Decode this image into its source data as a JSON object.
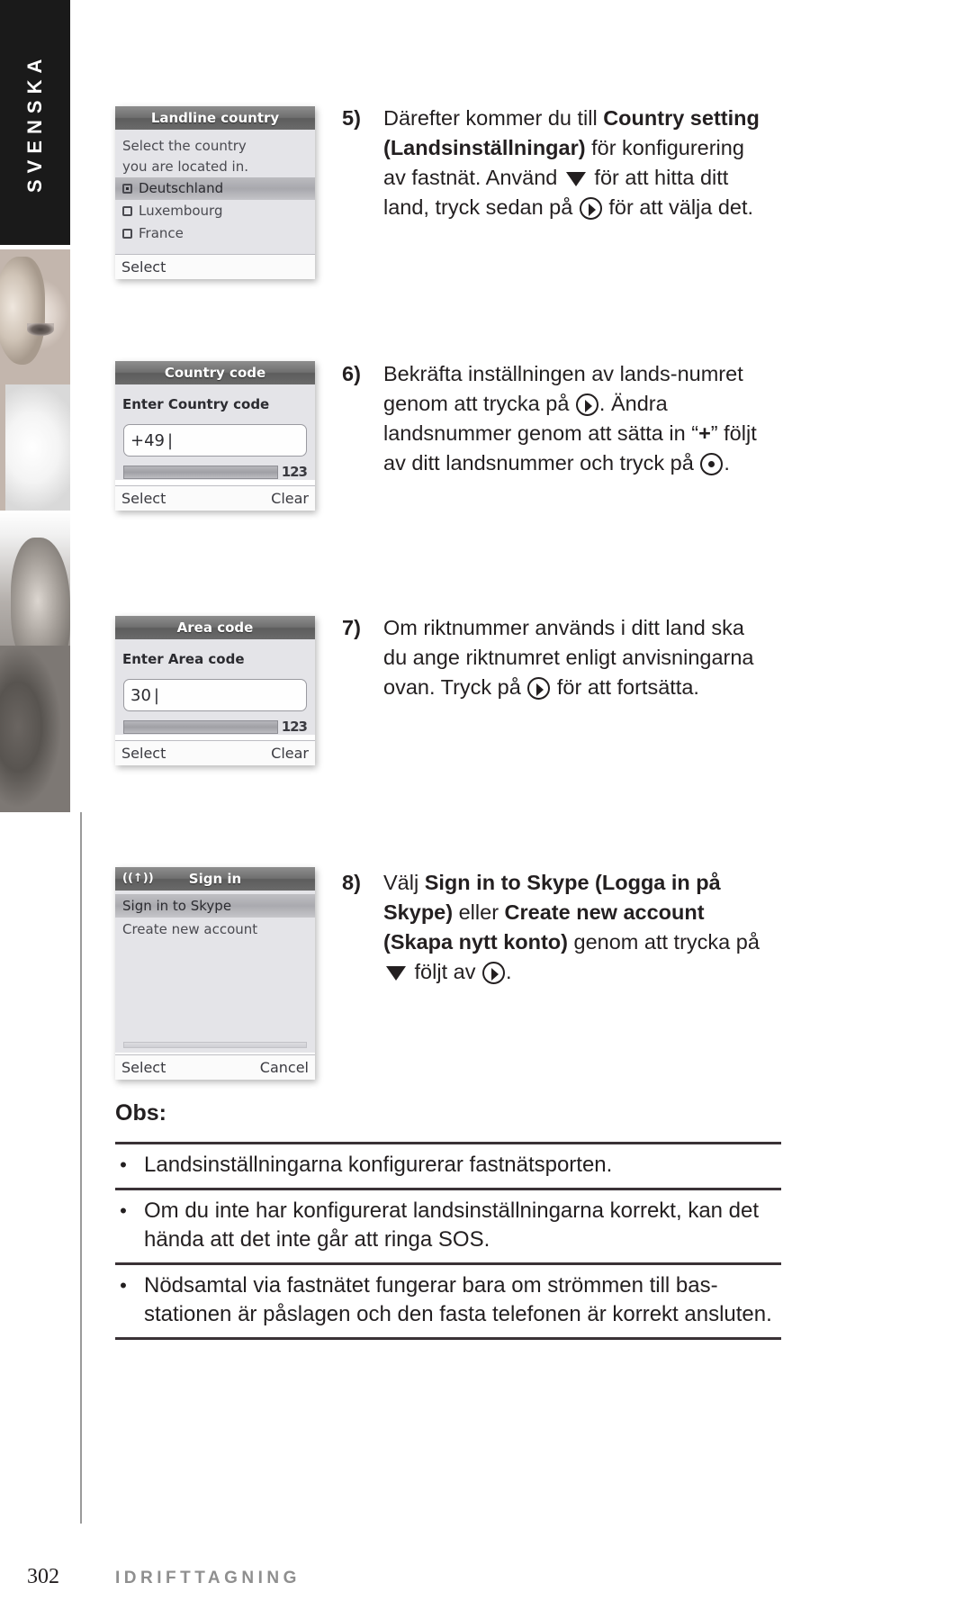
{
  "sidebar": {
    "language_tab": "SVENSKA"
  },
  "screens": [
    {
      "title": "Landline country",
      "prompt_line1": "Select the country",
      "prompt_line2": "you are located in.",
      "options": [
        {
          "label": "Deutschland",
          "selected": true
        },
        {
          "label": "Luxembourg",
          "selected": false
        },
        {
          "label": "France",
          "selected": false
        }
      ],
      "softkey_left": "Select",
      "softkey_right": ""
    },
    {
      "title": "Country code",
      "heading": "Enter Country code",
      "input_value": "+49",
      "ime_label": "123",
      "softkey_left": "Select",
      "softkey_right": "Clear"
    },
    {
      "title": "Area code",
      "heading": "Enter Area code",
      "input_value": "30",
      "ime_label": "123",
      "softkey_left": "Select",
      "softkey_right": "Clear"
    },
    {
      "title": "Sign in",
      "signal_icon": "signal-icon",
      "items": [
        {
          "label": "Sign in to Skype",
          "highlight": true
        },
        {
          "label": "Create new account",
          "highlight": false
        }
      ],
      "softkey_left": "Select",
      "softkey_right": "Cancel"
    }
  ],
  "steps": [
    {
      "number": "5)",
      "parts": [
        {
          "t": "Därefter kommer du till ",
          "b": false
        },
        {
          "t": "Country setting (Landsinställningar)",
          "b": true
        },
        {
          "t": " för konfigurering av fastnät. Använd ",
          "b": false
        },
        {
          "t": "#down",
          "b": false
        },
        {
          "t": " för att hitta ditt land, tryck sedan på ",
          "b": false
        },
        {
          "t": "#keyright",
          "b": false
        },
        {
          "t": " för att välja det.",
          "b": false
        }
      ]
    },
    {
      "number": "6)",
      "parts": [
        {
          "t": "Bekräfta inställningen av lands-numret genom att trycka på ",
          "b": false
        },
        {
          "t": "#keyright",
          "b": false
        },
        {
          "t": ". Ändra landsnummer genom att sätta in “",
          "b": false
        },
        {
          "t": "+",
          "b": true
        },
        {
          "t": "” följt av ditt landsnummer och tryck på ",
          "b": false
        },
        {
          "t": "#keydot",
          "b": false
        },
        {
          "t": ".",
          "b": false
        }
      ]
    },
    {
      "number": "7)",
      "parts": [
        {
          "t": "Om riktnummer används i ditt land ska du ange riktnumret enligt anvisningarna ovan. Tryck på ",
          "b": false
        },
        {
          "t": "#keyright",
          "b": false
        },
        {
          "t": " för att fortsätta.",
          "b": false
        }
      ]
    },
    {
      "number": "8)",
      "parts": [
        {
          "t": "Välj ",
          "b": false
        },
        {
          "t": "Sign in to Skype (Logga in på Skype)",
          "b": true
        },
        {
          "t": " eller ",
          "b": false
        },
        {
          "t": "Create new account (Skapa nytt konto)",
          "b": true
        },
        {
          "t": " genom att trycka på ",
          "b": false
        },
        {
          "t": "#down",
          "b": false
        },
        {
          "t": " följt av ",
          "b": false
        },
        {
          "t": "#keyright",
          "b": false
        },
        {
          "t": ".",
          "b": false
        }
      ]
    }
  ],
  "obs": {
    "title": "Obs:",
    "bullet": "•",
    "items": [
      "Landsinställningarna konfigurerar fastnätsporten.",
      "Om du inte har konfigurerat landsinställningarna korrekt, kan det hända att det inte går att ringa SOS.",
      "Nödsamtal via fastnätet fungerar bara om strömmen till bas-stationen är påslagen och den fasta telefonen är korrekt ansluten."
    ]
  },
  "footer": {
    "page_number": "302",
    "section_title": "IDRIFTTAGNING"
  },
  "colors": {
    "title_bar": "#6f6f6f",
    "screen_bg": "#e4e4e8",
    "text": "#231f20",
    "rule": "#3a3236",
    "footer_title": "#8f8f8f"
  }
}
